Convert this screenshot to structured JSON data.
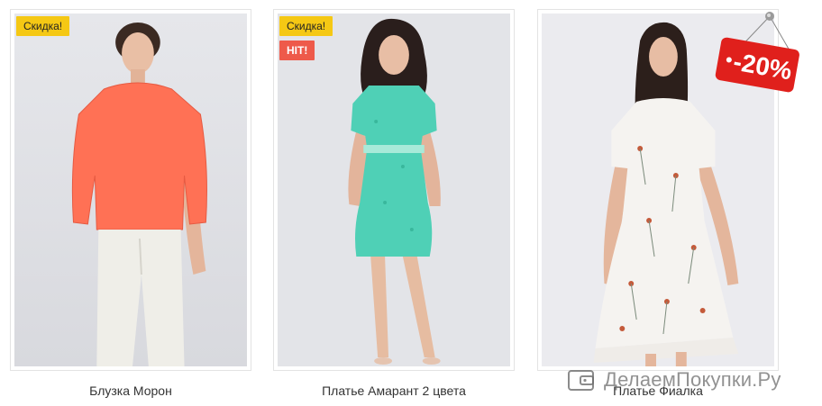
{
  "products": [
    {
      "name": "Блузка Морон",
      "badges": {
        "sale": "Скидка!"
      },
      "top_color": "#ff7155",
      "bottom_color": "#efeee8"
    },
    {
      "name": "Платье Амарант 2 цвета",
      "badges": {
        "sale": "Скидка!",
        "hit": "HIT!"
      },
      "dress_color": "#4fd0b6"
    },
    {
      "name": "Платье Фиалка",
      "badges": {},
      "dress_color": "#f5f3f0"
    }
  ],
  "discount_sticker": {
    "text": "-20%",
    "color": "#e0201c"
  },
  "watermark": {
    "text": "ДелаемПокупки.Ру"
  },
  "colors": {
    "sale_badge": "#f5c814",
    "hit_badge": "#ee5a4a",
    "photo_background": "#e8e9ed"
  }
}
